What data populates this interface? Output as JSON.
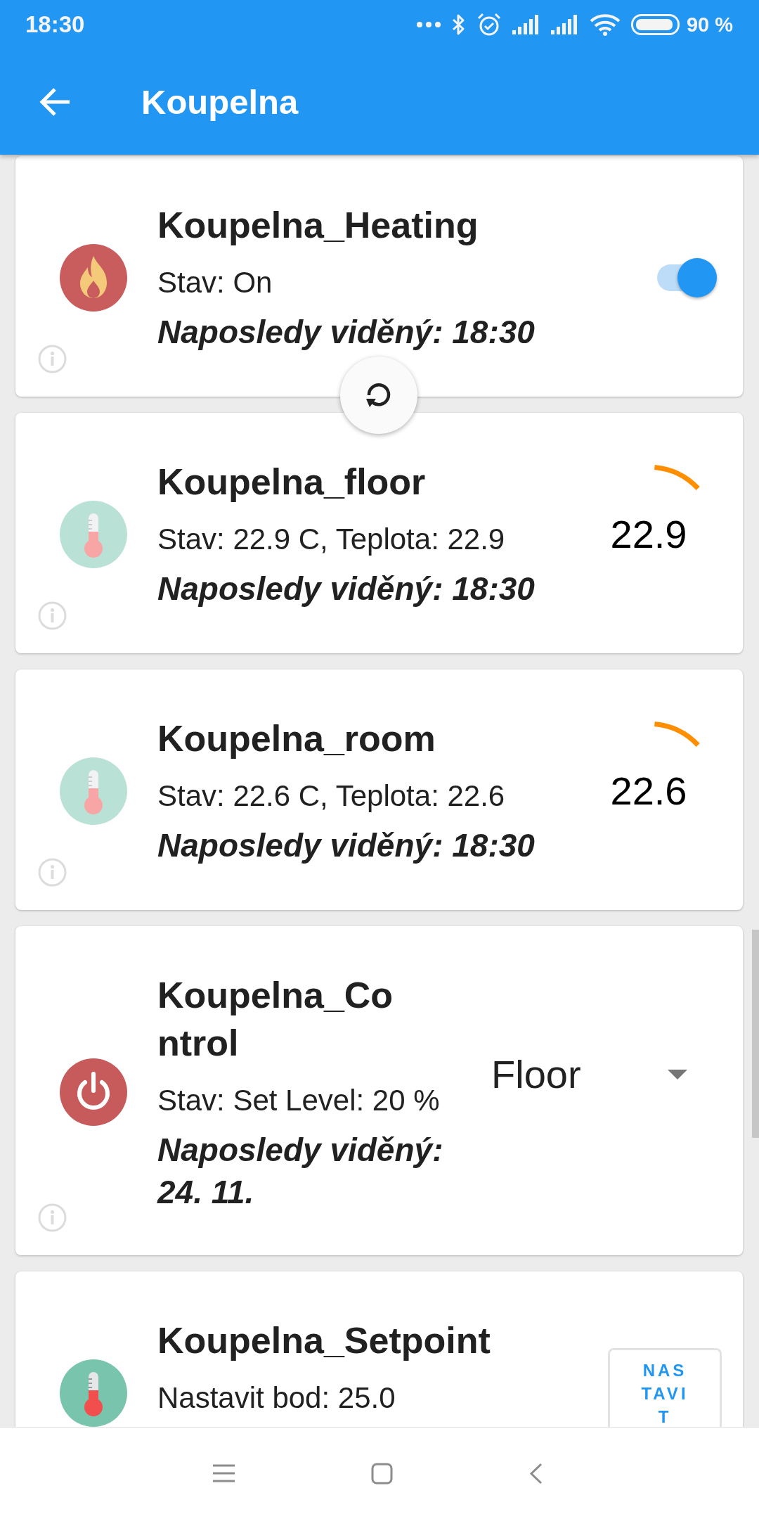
{
  "status_bar": {
    "time": "18:30",
    "battery": "90 %"
  },
  "app_bar": {
    "title": "Koupelna"
  },
  "devices": [
    {
      "kind": "switch",
      "faded": false,
      "name": "Koupelna_Heating",
      "status": "Stav: On",
      "last_seen": "Naposledy viděný: 18:30",
      "info": true,
      "on": true
    },
    {
      "kind": "gauge",
      "faded": true,
      "name": "Koupelna_floor",
      "status": "Stav: 22.9 C, Teplota: 22.9",
      "last_seen": "Naposledy viděný: 18:30",
      "info": true,
      "value": "22.9"
    },
    {
      "kind": "gauge",
      "faded": true,
      "name": "Koupelna_room",
      "status": "Stav: 22.6 C, Teplota: 22.6",
      "last_seen": "Naposledy viděný: 18:30",
      "info": true,
      "value": "22.6"
    },
    {
      "kind": "select",
      "faded": false,
      "name": "Koupelna_Control",
      "status": "Stav: Set Level: 20 %",
      "last_seen": "Naposledy viděný: 24. 11.",
      "info": true,
      "value": "Floor"
    },
    {
      "kind": "button",
      "faded": false,
      "name": "Koupelna_Setpoint",
      "status": "Nastavit bod: 25.0",
      "button": "NASTAVIT"
    }
  ]
}
